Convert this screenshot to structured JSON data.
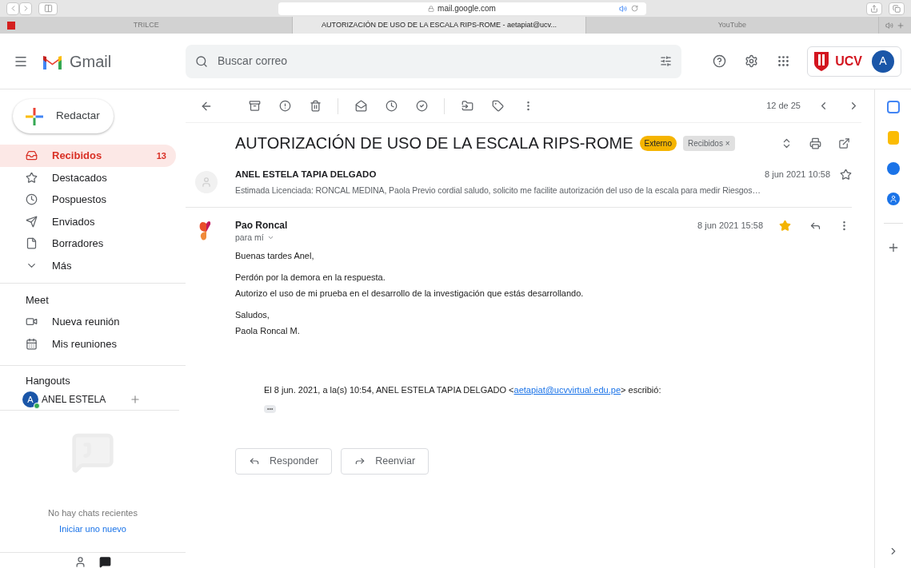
{
  "browser": {
    "url": "mail.google.com",
    "tabs": [
      {
        "title": "TRILCE",
        "selected": false
      },
      {
        "title": "AUTORIZACIÓN DE USO DE LA ESCALA RIPS-ROME - aetapiat@ucv...",
        "selected": true
      },
      {
        "title": "YouTube",
        "selected": false
      }
    ]
  },
  "header": {
    "app_name": "Gmail",
    "search_placeholder": "Buscar correo",
    "avatar": "A",
    "org_logo": "UCV"
  },
  "compose": "Redactar",
  "nav": [
    {
      "label": "Recibidos",
      "count": "13",
      "selected": true
    },
    {
      "label": "Destacados",
      "selected": false
    },
    {
      "label": "Pospuestos",
      "selected": false
    },
    {
      "label": "Enviados",
      "selected": false
    },
    {
      "label": "Borradores",
      "selected": false
    },
    {
      "label": "Más",
      "selected": false
    }
  ],
  "meet": {
    "title": "Meet",
    "items": [
      "Nueva reunión",
      "Mis reuniones"
    ]
  },
  "hangouts": {
    "title": "Hangouts",
    "user_initial": "A",
    "user_name": "ANEL ESTELA",
    "online": true,
    "empty_text": "No hay chats recientes",
    "start_link": "Iniciar uno nuevo"
  },
  "toolbar": {
    "position": "12 de 25"
  },
  "thread": {
    "subject": "AUTORIZACIÓN DE USO DE LA ESCALA RIPS-ROME",
    "labels": [
      {
        "text": "Externo",
        "kind": "external"
      },
      {
        "text": "Recibidos ×",
        "kind": "folder"
      }
    ]
  },
  "messages": [
    {
      "kind": "collapsed",
      "sender": "ANEL ESTELA TAPIA DELGADO",
      "date": "8 jun 2021 10:58",
      "starred": false,
      "snippet": "Estimada Licenciada: RONCAL MEDINA, Paola Previo cordial saludo, solicito me facilite autorización del uso de la escala para medir Riesgos…"
    },
    {
      "kind": "expanded",
      "sender": "Pao Roncal",
      "to": "para mí",
      "date": "8 jun 2021 15:58",
      "starred": true,
      "paragraphs": [
        [
          "Buenas tardes Anel,"
        ],
        [
          "Perdón por la demora en la respuesta.",
          "Autorizo el uso de mi prueba en el desarrollo de la investigación que estás desarrollando."
        ],
        [
          "Saludos,",
          "Paola Roncal M."
        ]
      ],
      "quote": {
        "before": "El 8 jun. 2021, a la(s) 10:54, ANEL ESTELA TAPIA DELGADO <",
        "email": "aetapiat@ucvvirtual.edu.pe",
        "after": "> escribió:",
        "ellipsis": "•••"
      }
    }
  ],
  "actions": [
    "Responder",
    "Reenviar"
  ]
}
